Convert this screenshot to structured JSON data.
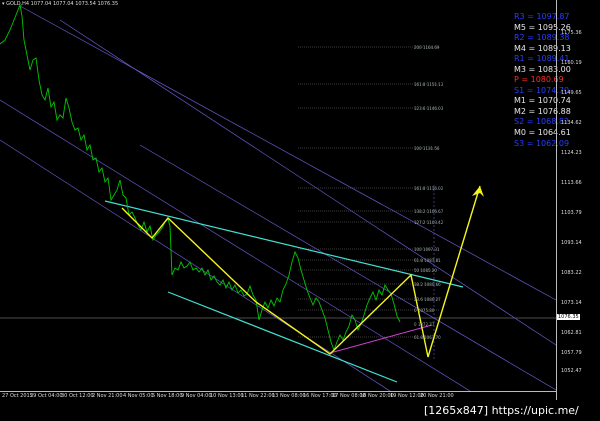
{
  "header": {
    "symbol_info": "GOLD,H4  1077.04 1077.04 1073.54 1076.35"
  },
  "price_axis": {
    "ticks": [
      "1175.36",
      "1160.19",
      "1149.65",
      "1134.62",
      "1124.23",
      "1113.66",
      "1103.79",
      "1093.14",
      "1083.22",
      "1073.14",
      "1062.81",
      "1057.79",
      "1052.47"
    ],
    "current_price": "1076.35"
  },
  "time_axis": {
    "ticks": [
      "27 Oct 2015",
      "29 Oct 04:00",
      "30 Oct 12:00",
      "2 Nov 21:00",
      "4 Nov 05:00",
      "5 Nov 18:00",
      "9 Nov 04:00",
      "10 Nov 13:00",
      "11 Nov 22:00",
      "13 Nov 08:00",
      "16 Nov 17:00",
      "17 Nov 08:00",
      "18 Nov 20:00",
      "19 Nov 12:00",
      "20 Nov 21:00"
    ]
  },
  "pivots": [
    {
      "label": "R3 = 1097.87",
      "color": "#2a3dff"
    },
    {
      "label": "M5 = 1095.26",
      "color": "#e8e8e8"
    },
    {
      "label": "R2 = 1089.38",
      "color": "#2a3dff"
    },
    {
      "label": "M4 = 1089.13",
      "color": "#e8e8e8"
    },
    {
      "label": "R1 = 1089.41",
      "color": "#2a3dff"
    },
    {
      "label": "M3 = 1083.00",
      "color": "#e8e8e8"
    },
    {
      "label": "P   = 1080.69",
      "color": "#ff2a2a"
    },
    {
      "label": "S1 = 1074.70",
      "color": "#2a3dff"
    },
    {
      "label": "M1 = 1070.74",
      "color": "#e8e8e8"
    },
    {
      "label": "M2 = 1076.88",
      "color": "#e8e8e8"
    },
    {
      "label": "S2 = 1068.82",
      "color": "#2a3dff"
    },
    {
      "label": "M0 = 1064.61",
      "color": "#e8e8e8"
    },
    {
      "label": "S3 = 1062.09",
      "color": "#2a3dff"
    }
  ],
  "fib_levels": [
    "200 1164.69",
    "161.8 1151.13",
    "123.6 1146.03",
    "100 1131.56",
    "161.8 1116.02",
    "138.2 1106.67",
    "127.2 1103.42",
    "100 1097.31",
    "61.8 1087.81",
    "50 1085.20",
    "38.2 1080.66",
    "23.6 1080.27",
    "0 1075.80",
    "0 1072.77",
    "61.8 1067.70"
  ],
  "watermark": "[1265x847] https://upic.me/",
  "colors": {
    "candles": "#00c800",
    "pattern": "#f5f51e",
    "channel": "#40e0d0",
    "trend_lines": "#7b68ee",
    "support": "#c040c0"
  }
}
